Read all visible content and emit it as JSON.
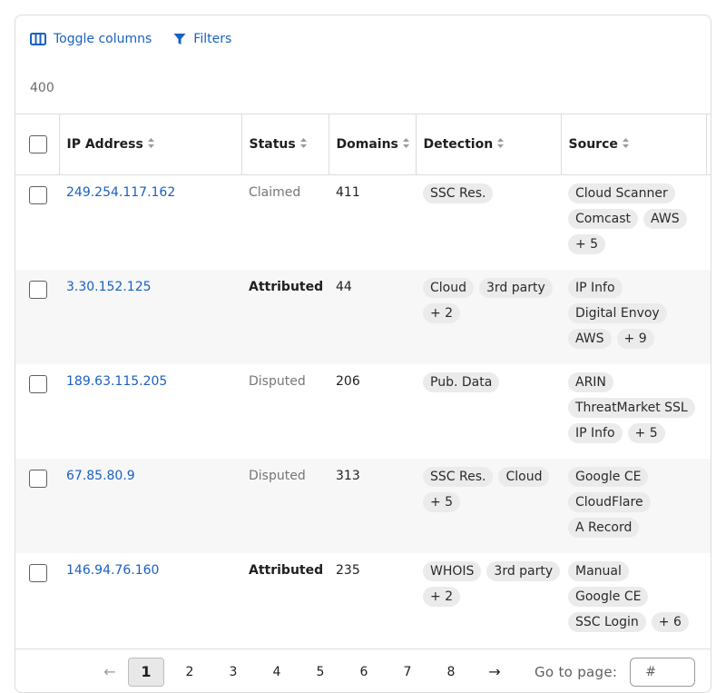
{
  "toolbar": {
    "toggle_columns_label": "Toggle columns",
    "filters_label": "Filters"
  },
  "result_count": "400",
  "table": {
    "headers": {
      "ip": "IP Address",
      "status": "Status",
      "domains": "Domains",
      "detection": "Detection",
      "source": "Source"
    },
    "rows": [
      {
        "ip": "249.254.117.162",
        "status": "Claimed",
        "status_bold": false,
        "domains": "411",
        "detection": [
          "SSC Res."
        ],
        "source": [
          "Cloud Scanner",
          "Comcast",
          "AWS",
          "+ 5"
        ]
      },
      {
        "ip": "3.30.152.125",
        "status": "Attributed",
        "status_bold": true,
        "domains": "44",
        "detection": [
          "Cloud",
          "3rd party",
          "+ 2"
        ],
        "source": [
          "IP Info",
          "Digital Envoy",
          "AWS",
          "+ 9"
        ]
      },
      {
        "ip": "189.63.115.205",
        "status": "Disputed",
        "status_bold": false,
        "domains": "206",
        "detection": [
          "Pub. Data"
        ],
        "source": [
          "ARIN",
          "ThreatMarket SSL",
          "IP Info",
          "+ 5"
        ]
      },
      {
        "ip": "67.85.80.9",
        "status": "Disputed",
        "status_bold": false,
        "domains": "313",
        "detection": [
          "SSC Res.",
          "Cloud",
          "+ 5"
        ],
        "source": [
          "Google CE",
          "CloudFlare",
          "A Record"
        ]
      },
      {
        "ip": "146.94.76.160",
        "status": "Attributed",
        "status_bold": true,
        "domains": "235",
        "detection": [
          "WHOIS",
          "3rd party",
          "+ 2"
        ],
        "source": [
          "Manual",
          "Google CE",
          "SSC Login",
          "+ 6"
        ]
      }
    ]
  },
  "pagination": {
    "prev_icon": "←",
    "next_icon": "→",
    "pages": [
      "1",
      "2",
      "3",
      "4",
      "5",
      "6",
      "7",
      "8"
    ],
    "current": "1",
    "goto_label": "Go to page:",
    "goto_placeholder": "#"
  },
  "colors": {
    "link": "#1960c0",
    "border": "#dcdcdc",
    "tag_bg": "#ebebeb",
    "row_alt_bg": "#f7f7f8"
  }
}
